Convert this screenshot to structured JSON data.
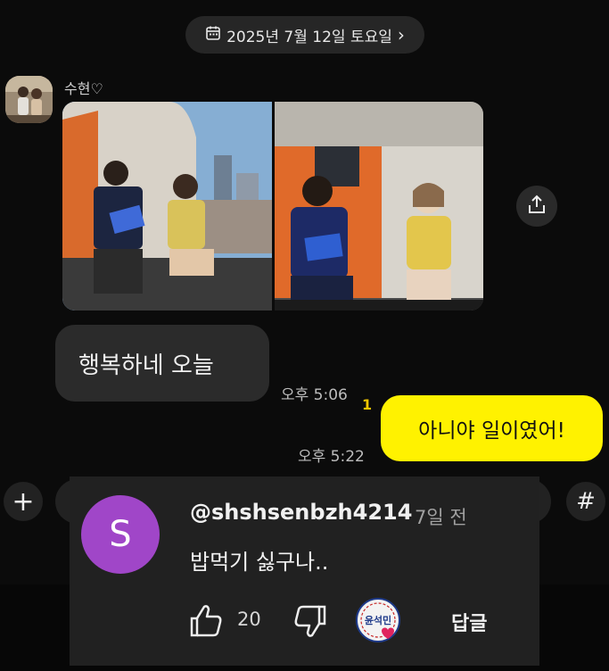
{
  "date_pill": {
    "label": "2025년 7월 12일 토요일",
    "icon": "calendar-icon",
    "chevron": "›"
  },
  "sender": {
    "name": "수현♡"
  },
  "messages": {
    "incoming_text": "행복하네 오늘",
    "incoming_time": "오후 5:06",
    "outgoing_text": "아니야 일이였어!",
    "outgoing_unread": "1",
    "outgoing_time": "오후 5:22"
  },
  "composer": {
    "plus": "+",
    "hash": "#"
  },
  "comment": {
    "avatar_letter": "S",
    "handle": "@shshsenbzh4214",
    "age": "7일 전",
    "text": "밥먹기 싫구나..",
    "like_count": "20",
    "reply_label": "답글",
    "creator_badge_text": "윤석민"
  },
  "colors": {
    "outgoing_bubble": "#fff200",
    "incoming_bubble": "#2b2b2b",
    "avatar_purple": "#a046c8",
    "background": "#0b0b0b"
  }
}
